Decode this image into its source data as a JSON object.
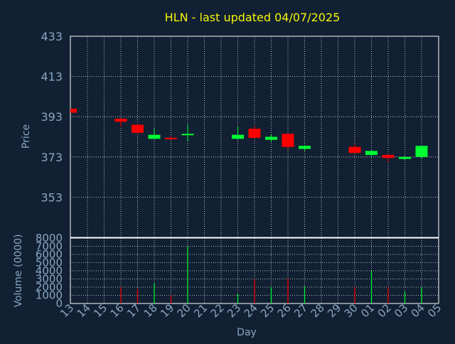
{
  "colors": {
    "background": "#112032",
    "title": "#f5f50a",
    "axis_text": "#8aa6c4",
    "frame": "#ffffff",
    "grid": "#ffffff",
    "up": "#00ff33",
    "down": "#ff0000"
  },
  "chart_data": [
    {
      "type": "candlestick",
      "title": "HLN - last updated 04/07/2025",
      "ylabel": "Price",
      "ylim": [
        333,
        433
      ],
      "yticks": [
        433,
        413,
        393,
        373,
        353
      ],
      "grid": true,
      "days": [
        "13",
        "14",
        "15",
        "16",
        "17",
        "18",
        "19",
        "20",
        "21",
        "22",
        "23",
        "24",
        "25",
        "26",
        "27",
        "28",
        "29",
        "30",
        "01",
        "02",
        "03",
        "04",
        "05"
      ],
      "candles": [
        {
          "day": "13",
          "open": 397,
          "close": 395,
          "high": 397,
          "low": 395
        },
        {
          "day": "16",
          "open": 392,
          "close": 390.5,
          "high": 392.5,
          "low": 388
        },
        {
          "day": "17",
          "open": 389,
          "close": 385,
          "high": 389.5,
          "low": 384.5
        },
        {
          "day": "18",
          "open": 382,
          "close": 384,
          "high": 387,
          "low": 381.5
        },
        {
          "day": "19",
          "open": 382.5,
          "close": 382,
          "high": 383.5,
          "low": 381.5
        },
        {
          "day": "20",
          "open": 384,
          "close": 384.5,
          "high": 389,
          "low": 381
        },
        {
          "day": "23",
          "open": 382,
          "close": 384,
          "high": 388,
          "low": 381.5
        },
        {
          "day": "24",
          "open": 387,
          "close": 382.5,
          "high": 388.5,
          "low": 382
        },
        {
          "day": "25",
          "open": 381.5,
          "close": 383,
          "high": 384,
          "low": 380.5
        },
        {
          "day": "26",
          "open": 384.5,
          "close": 378,
          "high": 384.5,
          "low": 377
        },
        {
          "day": "27",
          "open": 377,
          "close": 378.5,
          "high": 379,
          "low": 376
        },
        {
          "day": "30",
          "open": 378,
          "close": 375,
          "high": 379.5,
          "low": 374.5
        },
        {
          "day": "01",
          "open": 374,
          "close": 376,
          "high": 376.5,
          "low": 373
        },
        {
          "day": "02",
          "open": 374,
          "close": 372.5,
          "high": 374.5,
          "low": 370.5
        },
        {
          "day": "03",
          "open": 372,
          "close": 373,
          "high": 373.5,
          "low": 371.5
        },
        {
          "day": "04",
          "open": 373,
          "close": 378.5,
          "high": 378.5,
          "low": 372
        }
      ]
    },
    {
      "type": "bar",
      "ylabel": "Volume (0000)",
      "xlabel": "Day",
      "ylim": [
        0,
        8000
      ],
      "yticks": [
        8000,
        7000,
        6000,
        5000,
        4000,
        3000,
        2000,
        1000,
        0
      ],
      "grid": true,
      "volumes": [
        {
          "day": "16",
          "value": 2000,
          "dir": "down"
        },
        {
          "day": "17",
          "value": 1800,
          "dir": "down"
        },
        {
          "day": "18",
          "value": 2500,
          "dir": "up"
        },
        {
          "day": "19",
          "value": 1000,
          "dir": "down"
        },
        {
          "day": "20",
          "value": 7000,
          "dir": "up"
        },
        {
          "day": "23",
          "value": 1200,
          "dir": "up"
        },
        {
          "day": "24",
          "value": 3000,
          "dir": "down"
        },
        {
          "day": "25",
          "value": 2000,
          "dir": "up"
        },
        {
          "day": "26",
          "value": 3100,
          "dir": "down"
        },
        {
          "day": "27",
          "value": 2100,
          "dir": "up"
        },
        {
          "day": "30",
          "value": 2000,
          "dir": "down"
        },
        {
          "day": "01",
          "value": 4000,
          "dir": "up"
        },
        {
          "day": "02",
          "value": 2000,
          "dir": "down"
        },
        {
          "day": "03",
          "value": 1500,
          "dir": "up"
        },
        {
          "day": "04",
          "value": 2000,
          "dir": "up"
        }
      ]
    }
  ]
}
